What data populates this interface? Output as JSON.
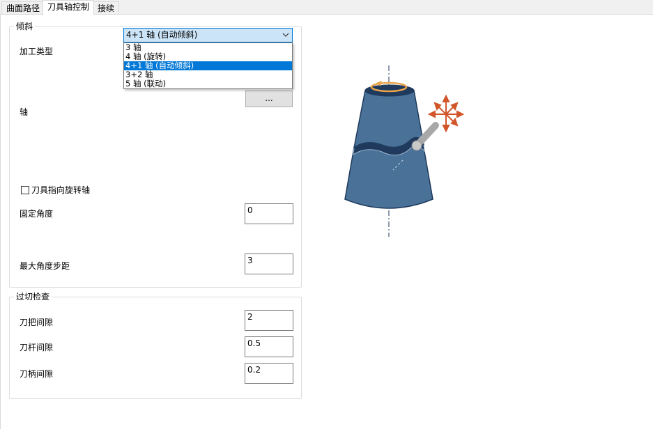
{
  "tabs": [
    {
      "label": "曲面路径"
    },
    {
      "label": "刀具轴控制"
    },
    {
      "label": "接续"
    }
  ],
  "tilt_group": {
    "title": "倾斜",
    "machining_type_label": "加工类型",
    "machining_type_value": "4+1 轴 (自动倾斜)",
    "options": [
      "3 轴",
      "4 轴 (旋转)",
      "4+1 轴 (自动倾斜)",
      "3+2 轴",
      "5 轴 (联动)"
    ],
    "axis_label": "轴",
    "axis_button": "...",
    "point_to_axis_label": "刀具指向旋转轴",
    "fixed_angle_label": "固定角度",
    "fixed_angle_value": "0",
    "max_angle_step_label": "最大角度步距",
    "max_angle_step_value": "3"
  },
  "gouge_group": {
    "title": "过切检查",
    "holder_clearance_label": "刀把间隙",
    "holder_clearance_value": "2",
    "shank_clearance_label": "刀杆间隙",
    "shank_clearance_value": "0.5",
    "arbor_clearance_label": "刀柄间隙",
    "arbor_clearance_value": "0.2"
  },
  "colors": {
    "accent": "#0078d7",
    "part_body": "#4a7299",
    "part_dark": "#1f3a5c",
    "rotation_arrow": "#e8a34a",
    "tilt_arrows": "#d2552a"
  }
}
